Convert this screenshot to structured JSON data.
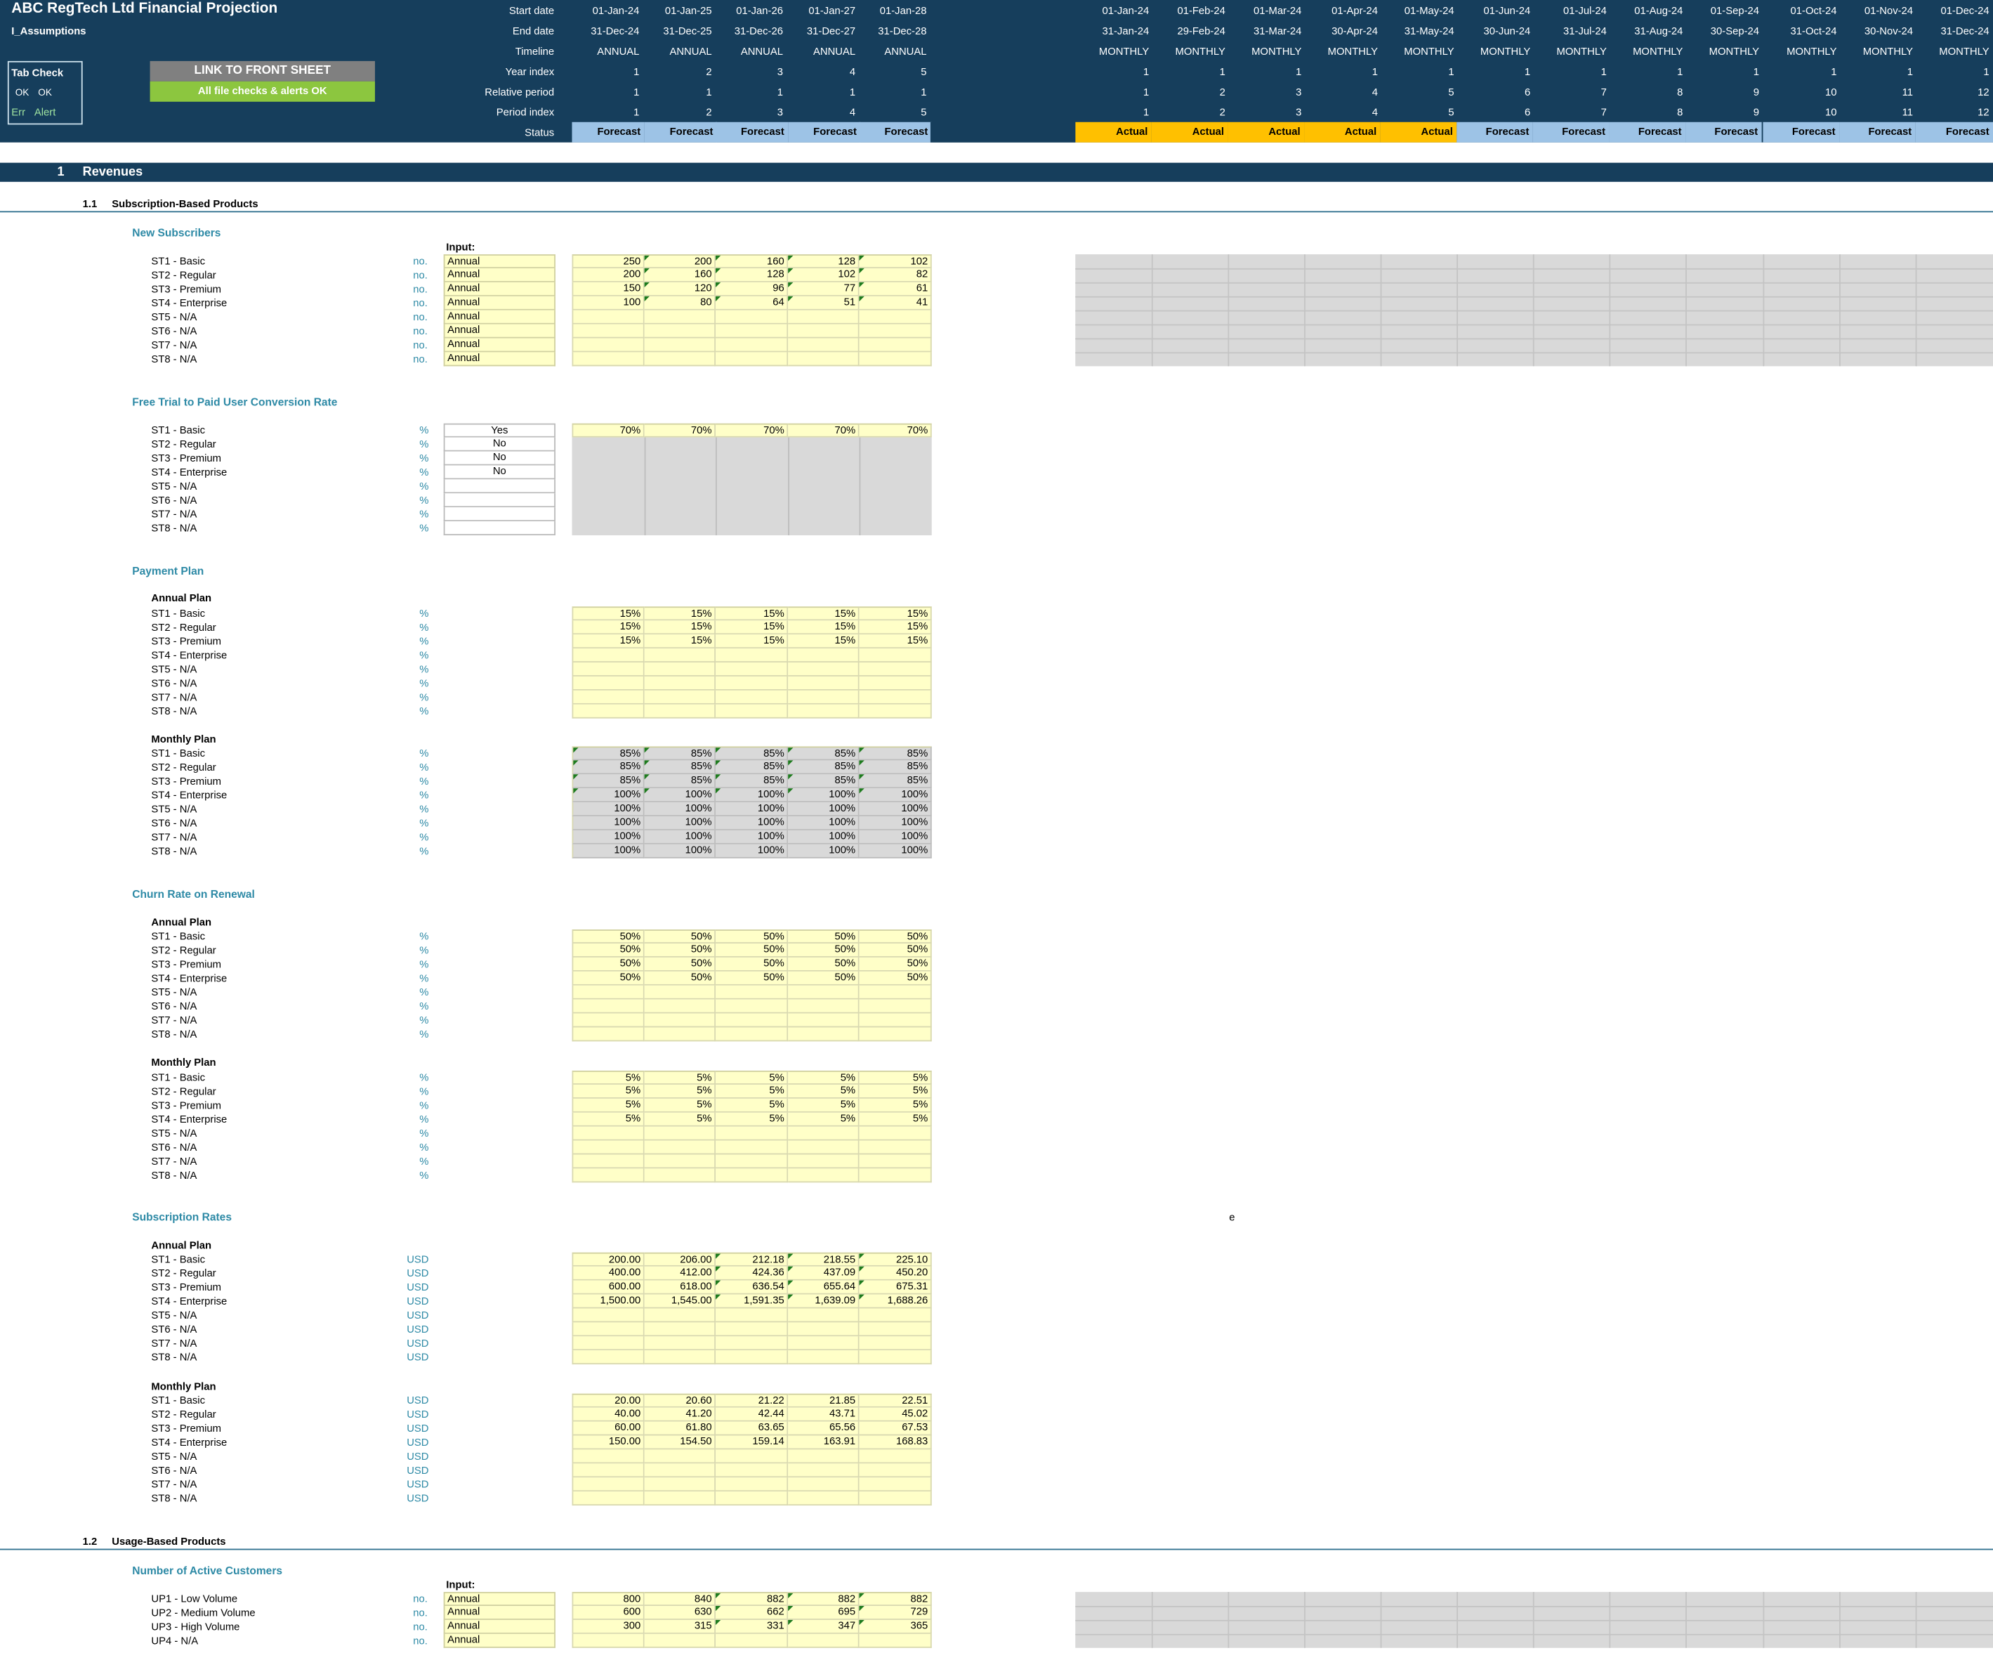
{
  "header": {
    "title": "ABC RegTech Ltd Financial Projection",
    "sheet": "I_Assumptions",
    "row_labels": [
      "Start date",
      "End date",
      "Timeline",
      "Year index",
      "Relative period",
      "Period index",
      "Status"
    ],
    "annual": {
      "start": [
        "01-Jan-24",
        "01-Jan-25",
        "01-Jan-26",
        "01-Jan-27",
        "01-Jan-28"
      ],
      "end": [
        "31-Dec-24",
        "31-Dec-25",
        "31-Dec-26",
        "31-Dec-27",
        "31-Dec-28"
      ],
      "timeline": [
        "ANNUAL",
        "ANNUAL",
        "ANNUAL",
        "ANNUAL",
        "ANNUAL"
      ],
      "year_index": [
        "1",
        "2",
        "3",
        "4",
        "5"
      ],
      "relative": [
        "1",
        "1",
        "1",
        "1",
        "1"
      ],
      "period": [
        "1",
        "2",
        "3",
        "4",
        "5"
      ],
      "status": [
        "Forecast",
        "Forecast",
        "Forecast",
        "Forecast",
        "Forecast"
      ]
    },
    "monthly": {
      "start": [
        "01-Jan-24",
        "01-Feb-24",
        "01-Mar-24",
        "01-Apr-24",
        "01-May-24",
        "01-Jun-24",
        "01-Jul-24",
        "01-Aug-24",
        "01-Sep-24",
        "01-Oct-24",
        "01-Nov-24",
        "01-Dec-24"
      ],
      "end": [
        "31-Jan-24",
        "29-Feb-24",
        "31-Mar-24",
        "30-Apr-24",
        "31-May-24",
        "30-Jun-24",
        "31-Jul-24",
        "31-Aug-24",
        "30-Sep-24",
        "31-Oct-24",
        "30-Nov-24",
        "31-Dec-24"
      ],
      "timeline": [
        "MONTHLY",
        "MONTHLY",
        "MONTHLY",
        "MONTHLY",
        "MONTHLY",
        "MONTHLY",
        "MONTHLY",
        "MONTHLY",
        "MONTHLY",
        "MONTHLY",
        "MONTHLY",
        "MONTHLY"
      ],
      "year_index": [
        "1",
        "1",
        "1",
        "1",
        "1",
        "1",
        "1",
        "1",
        "1",
        "1",
        "1",
        "1"
      ],
      "relative": [
        "1",
        "2",
        "3",
        "4",
        "5",
        "6",
        "7",
        "8",
        "9",
        "10",
        "11",
        "12"
      ],
      "period": [
        "1",
        "2",
        "3",
        "4",
        "5",
        "6",
        "7",
        "8",
        "9",
        "10",
        "11",
        "12"
      ],
      "status": [
        "Actual",
        "Actual",
        "Actual",
        "Actual",
        "Actual",
        "Forecast",
        "Forecast",
        "Forecast",
        "Forecast",
        "Forecast",
        "Forecast",
        "Forecast"
      ]
    },
    "tab_check": {
      "title": "Tab Check",
      "ok1": "OK",
      "ok2": "OK",
      "err": "Err",
      "alert": "Alert"
    },
    "link_button": "LINK TO FRONT SHEET",
    "checks_status": "All file checks & alerts OK",
    "colors": {
      "header_bg": "#163e5c",
      "actual": "#ffc000",
      "forecast": "#9dc3e6",
      "checks_ok": "#8cc63f",
      "link_btn": "#808080",
      "input_cell": "#ffffc8"
    }
  },
  "section": {
    "num": "1",
    "title": "Revenues"
  },
  "sub1": {
    "num": "1.1",
    "title": "Subscription-Based Products"
  },
  "sub2": {
    "num": "1.2",
    "title": "Usage-Based Products"
  },
  "input_label": "Input:",
  "blocks": {
    "new_subscribers": {
      "title": "New Subscribers",
      "labels": [
        "ST1 - Basic",
        "ST2 - Regular",
        "ST3 - Premium",
        "ST4 - Enterprise",
        "ST5 - N/A",
        "ST6 - N/A",
        "ST7 - N/A",
        "ST8 - N/A"
      ],
      "unit": "no.",
      "inputs": [
        "Annual",
        "Annual",
        "Annual",
        "Annual",
        "Annual",
        "Annual",
        "Annual",
        "Annual"
      ],
      "values": [
        [
          "250",
          "200",
          "160",
          "128",
          "102"
        ],
        [
          "200",
          "160",
          "128",
          "102",
          "82"
        ],
        [
          "150",
          "120",
          "96",
          "77",
          "61"
        ],
        [
          "100",
          "80",
          "64",
          "51",
          "41"
        ],
        [
          "",
          "",
          "",
          "",
          ""
        ],
        [
          "",
          "",
          "",
          "",
          ""
        ],
        [
          "",
          "",
          "",
          "",
          ""
        ],
        [
          "",
          "",
          "",
          "",
          ""
        ]
      ]
    },
    "conversion": {
      "title": "Free Trial to Paid User Conversion Rate",
      "labels": [
        "ST1 - Basic",
        "ST2 - Regular",
        "ST3 - Premium",
        "ST4 - Enterprise",
        "ST5 - N/A",
        "ST6 - N/A",
        "ST7 - N/A",
        "ST8 - N/A"
      ],
      "unit": "%",
      "inputs": [
        "Yes",
        "No",
        "No",
        "No",
        "",
        "",
        "",
        ""
      ],
      "values": [
        [
          "70%",
          "70%",
          "70%",
          "70%",
          "70%"
        ]
      ]
    },
    "payment_plan": {
      "title": "Payment Plan",
      "annual_title": "Annual Plan",
      "monthly_title": "Monthly Plan",
      "labels": [
        "ST1 - Basic",
        "ST2 - Regular",
        "ST3 - Premium",
        "ST4 - Enterprise",
        "ST5 - N/A",
        "ST6 - N/A",
        "ST7 - N/A",
        "ST8 - N/A"
      ],
      "unit": "%",
      "annual": [
        [
          "15%",
          "15%",
          "15%",
          "15%",
          "15%"
        ],
        [
          "15%",
          "15%",
          "15%",
          "15%",
          "15%"
        ],
        [
          "15%",
          "15%",
          "15%",
          "15%",
          "15%"
        ],
        [
          "",
          "",
          "",
          "",
          ""
        ],
        [
          "",
          "",
          "",
          "",
          ""
        ],
        [
          "",
          "",
          "",
          "",
          ""
        ],
        [
          "",
          "",
          "",
          "",
          ""
        ],
        [
          "",
          "",
          "",
          "",
          ""
        ]
      ],
      "monthly": [
        [
          "85%",
          "85%",
          "85%",
          "85%",
          "85%"
        ],
        [
          "85%",
          "85%",
          "85%",
          "85%",
          "85%"
        ],
        [
          "85%",
          "85%",
          "85%",
          "85%",
          "85%"
        ],
        [
          "100%",
          "100%",
          "100%",
          "100%",
          "100%"
        ],
        [
          "100%",
          "100%",
          "100%",
          "100%",
          "100%"
        ],
        [
          "100%",
          "100%",
          "100%",
          "100%",
          "100%"
        ],
        [
          "100%",
          "100%",
          "100%",
          "100%",
          "100%"
        ],
        [
          "100%",
          "100%",
          "100%",
          "100%",
          "100%"
        ]
      ]
    },
    "churn": {
      "title": "Churn Rate on Renewal",
      "annual_title": "Annual Plan",
      "monthly_title": "Monthly Plan",
      "labels": [
        "ST1 - Basic",
        "ST2 - Regular",
        "ST3 - Premium",
        "ST4 - Enterprise",
        "ST5 - N/A",
        "ST6 - N/A",
        "ST7 - N/A",
        "ST8 - N/A"
      ],
      "unit": "%",
      "annual": [
        [
          "50%",
          "50%",
          "50%",
          "50%",
          "50%"
        ],
        [
          "50%",
          "50%",
          "50%",
          "50%",
          "50%"
        ],
        [
          "50%",
          "50%",
          "50%",
          "50%",
          "50%"
        ],
        [
          "50%",
          "50%",
          "50%",
          "50%",
          "50%"
        ],
        [
          "",
          "",
          "",
          "",
          ""
        ],
        [
          "",
          "",
          "",
          "",
          ""
        ],
        [
          "",
          "",
          "",
          "",
          ""
        ],
        [
          "",
          "",
          "",
          "",
          ""
        ]
      ],
      "monthly": [
        [
          "5%",
          "5%",
          "5%",
          "5%",
          "5%"
        ],
        [
          "5%",
          "5%",
          "5%",
          "5%",
          "5%"
        ],
        [
          "5%",
          "5%",
          "5%",
          "5%",
          "5%"
        ],
        [
          "5%",
          "5%",
          "5%",
          "5%",
          "5%"
        ],
        [
          "",
          "",
          "",
          "",
          ""
        ],
        [
          "",
          "",
          "",
          "",
          ""
        ],
        [
          "",
          "",
          "",
          "",
          ""
        ],
        [
          "",
          "",
          "",
          "",
          ""
        ]
      ]
    },
    "rates": {
      "title": "Subscription Rates",
      "stray": "e",
      "annual_title": "Annual Plan",
      "monthly_title": "Monthly Plan",
      "labels": [
        "ST1 - Basic",
        "ST2 - Regular",
        "ST3 - Premium",
        "ST4 - Enterprise",
        "ST5 - N/A",
        "ST6 - N/A",
        "ST7 - N/A",
        "ST8 - N/A"
      ],
      "unit": "USD",
      "annual": [
        [
          "200.00",
          "206.00",
          "212.18",
          "218.55",
          "225.10"
        ],
        [
          "400.00",
          "412.00",
          "424.36",
          "437.09",
          "450.20"
        ],
        [
          "600.00",
          "618.00",
          "636.54",
          "655.64",
          "675.31"
        ],
        [
          "1,500.00",
          "1,545.00",
          "1,591.35",
          "1,639.09",
          "1,688.26"
        ],
        [
          "",
          "",
          "",
          "",
          ""
        ],
        [
          "",
          "",
          "",
          "",
          ""
        ],
        [
          "",
          "",
          "",
          "",
          ""
        ],
        [
          "",
          "",
          "",
          "",
          ""
        ]
      ],
      "monthly": [
        [
          "20.00",
          "20.60",
          "21.22",
          "21.85",
          "22.51"
        ],
        [
          "40.00",
          "41.20",
          "42.44",
          "43.71",
          "45.02"
        ],
        [
          "60.00",
          "61.80",
          "63.65",
          "65.56",
          "67.53"
        ],
        [
          "150.00",
          "154.50",
          "159.14",
          "163.91",
          "168.83"
        ],
        [
          "",
          "",
          "",
          "",
          ""
        ],
        [
          "",
          "",
          "",
          "",
          ""
        ],
        [
          "",
          "",
          "",
          "",
          ""
        ],
        [
          "",
          "",
          "",
          "",
          ""
        ]
      ]
    },
    "active_customers": {
      "title": "Number of Active Customers",
      "labels": [
        "UP1 - Low Volume",
        "UP2 - Medium Volume",
        "UP3 - High Volume",
        "UP4 - N/A"
      ],
      "unit": "no.",
      "inputs": [
        "Annual",
        "Annual",
        "Annual",
        "Annual"
      ],
      "values": [
        [
          "800",
          "840",
          "882",
          "882",
          "882"
        ],
        [
          "600",
          "630",
          "662",
          "695",
          "729"
        ],
        [
          "300",
          "315",
          "331",
          "347",
          "365"
        ],
        [
          "",
          "",
          "",
          "",
          ""
        ]
      ]
    }
  }
}
